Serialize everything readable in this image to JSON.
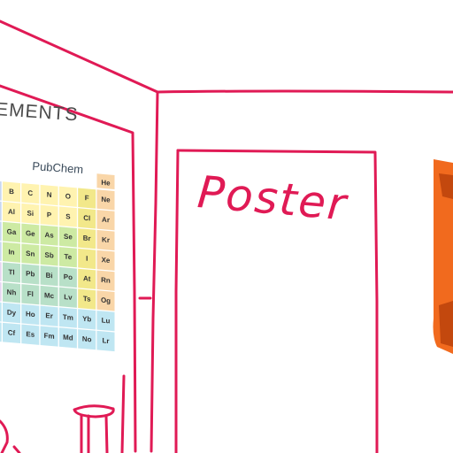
{
  "periodic_table_poster": {
    "title": "EMENTS",
    "source_logo": "PubChem",
    "element_symbols": [
      [
        "B",
        "C",
        "N",
        "O",
        "F",
        "Ne"
      ],
      [
        "Al",
        "Si",
        "P",
        "S",
        "Cl",
        "Ar"
      ],
      [
        "Ga",
        "Ge",
        "As",
        "Se",
        "Br",
        "Kr"
      ],
      [
        "In",
        "Sn",
        "Sb",
        "Te",
        "I",
        "Xe"
      ],
      [
        "Tl",
        "Pb",
        "Bi",
        "Po",
        "At",
        "Rn"
      ],
      [
        "Nh",
        "Fl",
        "Mc",
        "Lv",
        "Ts",
        "Og"
      ],
      [
        "Dy",
        "Ho",
        "Er",
        "Tm",
        "Yb",
        "Lu"
      ],
      [
        "Cf",
        "Es",
        "Fm",
        "Md",
        "No",
        "Lr"
      ]
    ],
    "header_symbols": [
      "He"
    ]
  },
  "wall_poster": {
    "label": "Poster"
  },
  "colors": {
    "sketch_line": "#e01a55",
    "nonmetal": "#fff3b0",
    "metalloid": "#cdeaa3",
    "halogen": "#f2e88a",
    "noble_gas": "#f9d6a8",
    "lanthanide": "#bfe6f2",
    "post_transition": "#b8e0c8",
    "orange_object": "#f16a1e",
    "orange_object_dark": "#c3480e"
  }
}
